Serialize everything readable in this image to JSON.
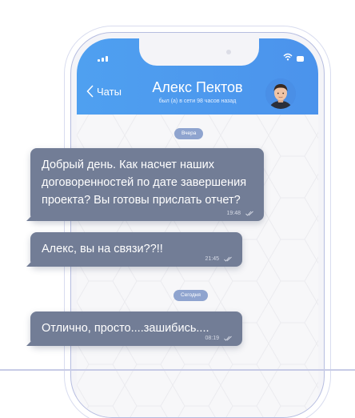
{
  "header": {
    "back_label": "Чаты",
    "contact_name": "Алекс Пектов",
    "status": "был (а) в сети 98 часов назад"
  },
  "dates": {
    "yesterday": "Вчера",
    "today": "Сегодня"
  },
  "messages": [
    {
      "text": "Добрый день. Как насчет наших договоренностей по дате завершения проекта? Вы готовы прислать отчет?",
      "time": "19:48"
    },
    {
      "text": "Алекс, вы на связи??!!",
      "time": "21:45"
    },
    {
      "text": "Отлично, просто....зашибись....",
      "time": "08:19"
    }
  ],
  "colors": {
    "header": "#4b93ec",
    "bubble": "#727d96",
    "date_pill": "#8fa4cf"
  },
  "icons": [
    "signal-icon",
    "wifi-icon",
    "battery-icon",
    "back-chevron-icon",
    "read-check-icon"
  ]
}
